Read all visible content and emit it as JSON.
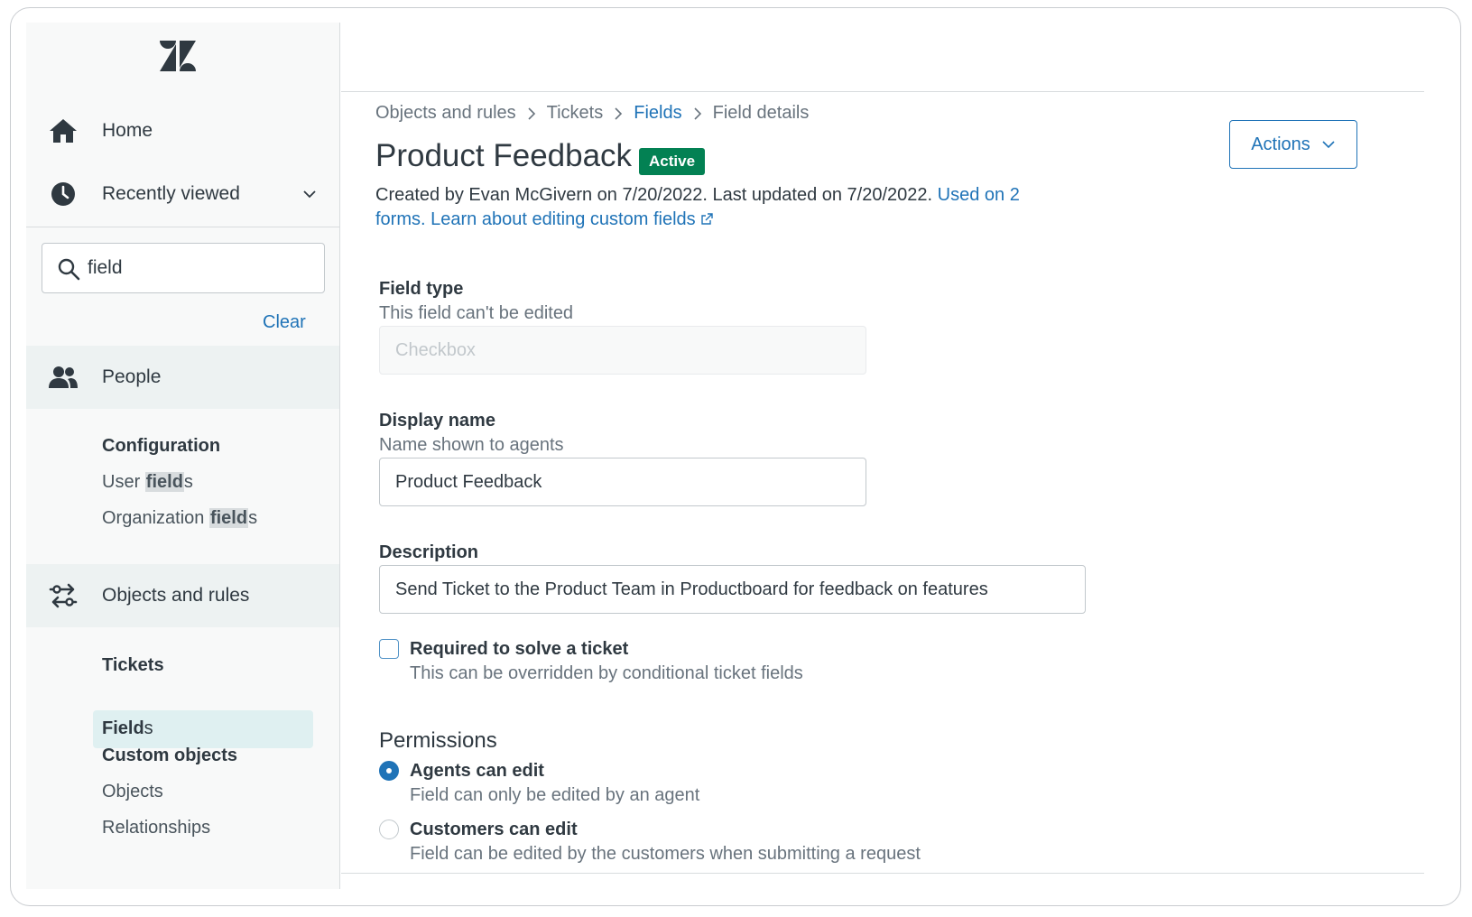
{
  "sidebar": {
    "logo": "zendesk-logo",
    "home_label": "Home",
    "recently_viewed_label": "Recently viewed",
    "search": {
      "value": "field",
      "placeholder": ""
    },
    "clear_label": "Clear",
    "people_label": "People",
    "configuration_heading": "Configuration",
    "user_fields": {
      "prefix": "User ",
      "match": "field",
      "suffix": "s"
    },
    "organization_fields": {
      "prefix": "Organization ",
      "match": "field",
      "suffix": "s"
    },
    "objects_rules_label": "Objects and rules",
    "tickets_heading": "Tickets",
    "fields_item": {
      "match": "Field",
      "suffix": "s"
    },
    "custom_objects_heading": "Custom objects",
    "objects_label": "Objects",
    "relationships_label": "Relationships"
  },
  "breadcrumb": {
    "items": [
      "Objects and rules",
      "Tickets",
      "Fields",
      "Field details"
    ]
  },
  "header": {
    "title": "Product Feedback",
    "status": "Active",
    "actions_label": "Actions",
    "meta_text": "Created by Evan McGivern on 7/20/2022. Last updated on 7/20/2022. ",
    "used_on_link": "Used on 2 forms.",
    "learn_link": "Learn about editing custom fields"
  },
  "form": {
    "field_type": {
      "label": "Field type",
      "hint": "This field can't be edited",
      "value": "Checkbox"
    },
    "display_name": {
      "label": "Display name",
      "hint": "Name shown to agents",
      "value": "Product Feedback"
    },
    "description": {
      "label": "Description",
      "value": "Send Ticket to the Product Team in Productboard for feedback on features"
    },
    "required": {
      "label": "Required to solve a ticket",
      "hint": "This can be overridden by conditional ticket fields",
      "checked": false
    },
    "permissions": {
      "title": "Permissions",
      "options": [
        {
          "label": "Agents can edit",
          "hint": "Field can only be edited by an agent",
          "selected": true
        },
        {
          "label": "Customers can edit",
          "hint": "Field can be edited by the customers when submitting a request",
          "selected": false
        }
      ]
    }
  },
  "colors": {
    "accent": "#1f73b7",
    "status_active": "#038153",
    "sidebar_bg": "#f8f9f9",
    "active_item_bg": "#dff0f1"
  }
}
